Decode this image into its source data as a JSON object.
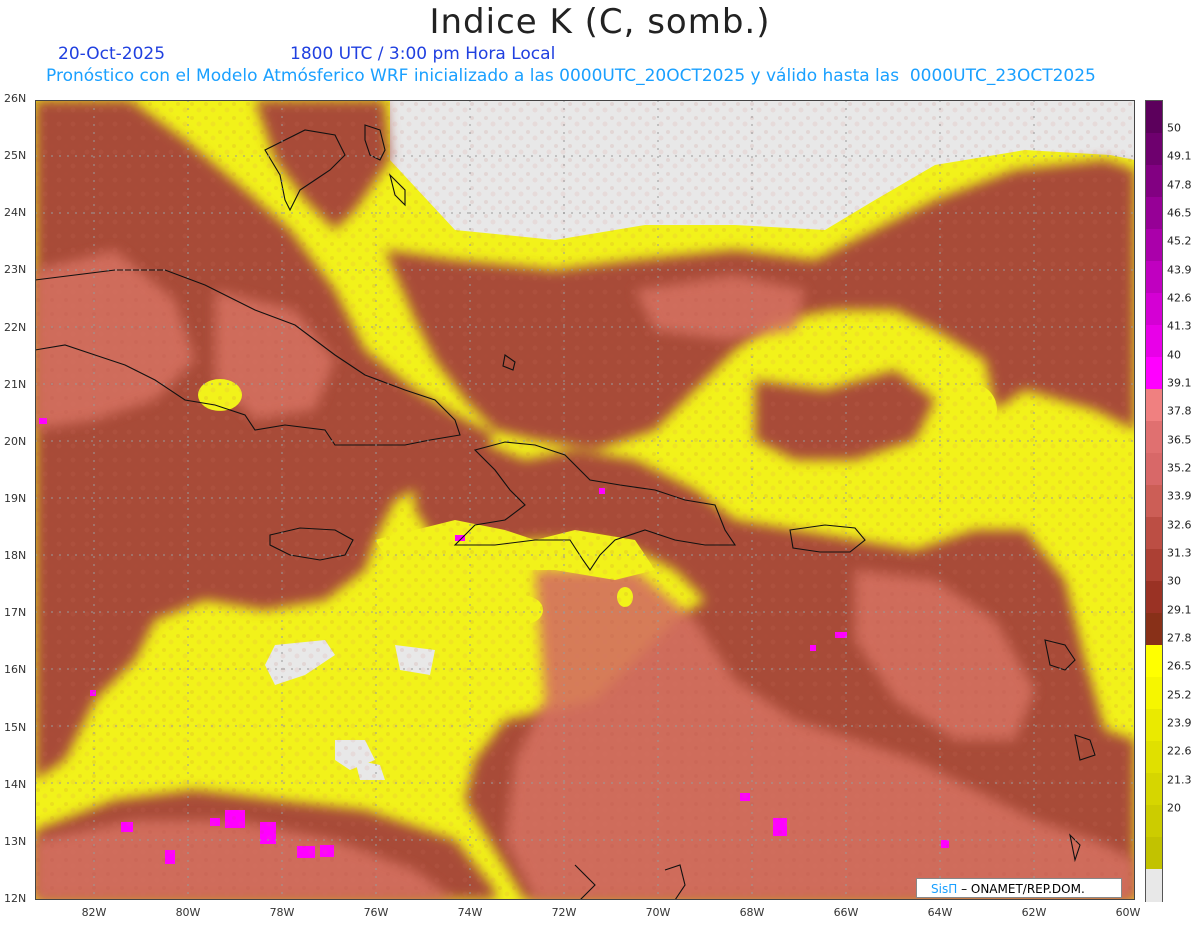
{
  "header": {
    "title": "Indice K (C, somb.)",
    "date": "20-Oct-2025",
    "time": "1800 UTC / 3:00 pm Hora Local",
    "subtitle": "Pronóstico con el Modelo Atmósferico WRF inicializado a las 0000UTC_20OCT2025 y válido hasta las  0000UTC_23OCT2025"
  },
  "axes": {
    "lat_labels": [
      "26N",
      "25N",
      "24N",
      "23N",
      "22N",
      "21N",
      "20N",
      "19N",
      "18N",
      "17N",
      "16N",
      "15N",
      "14N",
      "13N",
      "12N"
    ],
    "lon_labels": [
      "82W",
      "80W",
      "78W",
      "76W",
      "74W",
      "72W",
      "70W",
      "68W",
      "66W",
      "64W",
      "62W",
      "60W"
    ]
  },
  "colorbar": {
    "labels": [
      "50",
      "49.1",
      "47.8",
      "46.5",
      "45.2",
      "43.9",
      "42.6",
      "41.3",
      "40",
      "39.1",
      "37.8",
      "36.5",
      "35.2",
      "33.9",
      "32.6",
      "31.3",
      "30",
      "29.1",
      "27.8",
      "26.5",
      "25.2",
      "23.9",
      "22.6",
      "21.3",
      "20"
    ],
    "colors": [
      "#5c005c",
      "#6e006e",
      "#820082",
      "#960096",
      "#aa00aa",
      "#c000c0",
      "#d400d4",
      "#e800e8",
      "#ff00ff",
      "#f08080",
      "#e07070",
      "#d86868",
      "#cc5e56",
      "#bc4e44",
      "#ac4034",
      "#9a3224",
      "#883018",
      "#ffff00",
      "#f6f600",
      "#eaea00",
      "#e0e000",
      "#d6d600",
      "#cccc00",
      "#c2c200",
      "#e8e8e8"
    ]
  },
  "colors": {
    "land_bg": "#e8e8e8",
    "yellow": "#f2f21a",
    "red_dark": "#a34a36",
    "red_mid": "#c05e4e",
    "red_light": "#d8766a",
    "magenta": "#ff00ff",
    "coast": "#111111",
    "grid": "#9a9a9a"
  },
  "credit": {
    "logo": "SisΠ",
    "text": "– ONAMET/REP.DOM."
  }
}
